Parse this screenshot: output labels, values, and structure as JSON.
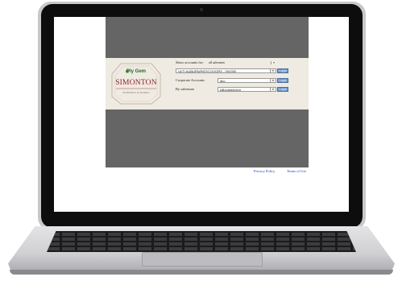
{
  "brand": {
    "plygem": "Ply Gem",
    "name": "SIMONTON",
    "tagline": "WINDOWS & DOORS"
  },
  "form": {
    "show_label": "Show accounts for:",
    "show_value": "all salesmen",
    "account_value": "(A/T) AUBURN/PATIO DOORS - 004785",
    "corporate_label": "Corporate Accounts",
    "corporate_value": "abc",
    "salesman_label": "By salesman",
    "salesman_value": "ABookkeeping",
    "login_label": "Login",
    "arrow_glyph": "▾"
  },
  "footer": {
    "privacy": "Privacy Policy",
    "terms": "Terms of Use"
  },
  "colors": {
    "frame": "#656565",
    "band": "#efeae2",
    "brand_red": "#8a2323",
    "brand_green": "#1f6b2e",
    "button": "#6f95c9",
    "link": "#1a3fb5"
  }
}
